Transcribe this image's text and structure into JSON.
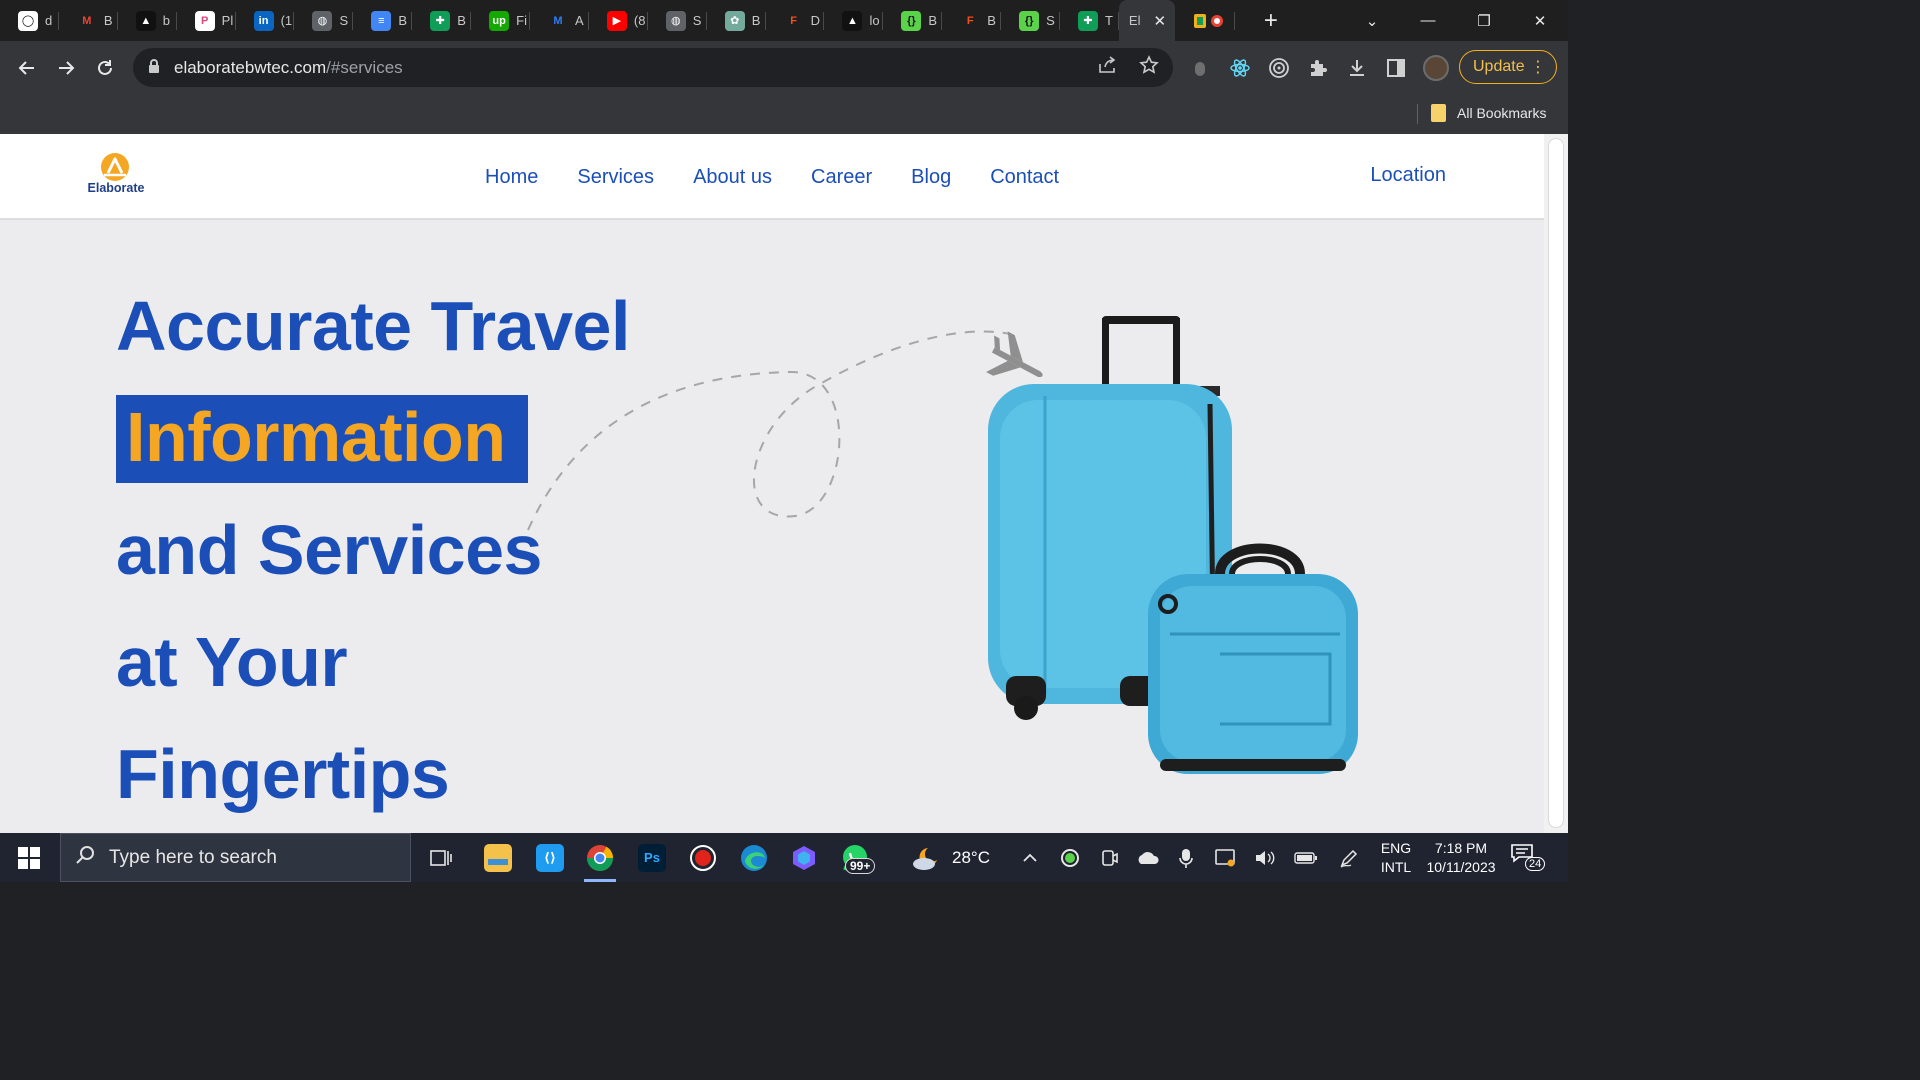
{
  "browser": {
    "tabs": [
      {
        "icon": "github-icon",
        "title": "d",
        "bg": "#ffffff",
        "fg": "#111111",
        "glyph": "◯"
      },
      {
        "icon": "gmail-icon",
        "title": "B",
        "bg": "#1f1f1f",
        "fg": "#ea4335",
        "glyph": "M"
      },
      {
        "icon": "vercel-icon",
        "title": "b",
        "bg": "#111111",
        "fg": "#ffffff",
        "glyph": "▲"
      },
      {
        "icon": "plane-app-icon",
        "title": "Pl",
        "bg": "#ffffff",
        "fg": "#e0457b",
        "glyph": "P"
      },
      {
        "icon": "linkedin-icon",
        "title": "(1",
        "bg": "#0a66c2",
        "fg": "#ffffff",
        "glyph": "in"
      },
      {
        "icon": "globe-icon",
        "title": "S",
        "bg": "#5f6368",
        "fg": "#ffffff",
        "glyph": "◍"
      },
      {
        "icon": "docs-icon",
        "title": "B",
        "bg": "#4285f4",
        "fg": "#ffffff",
        "glyph": "≡"
      },
      {
        "icon": "sheets-icon",
        "title": "B",
        "bg": "#0f9d58",
        "fg": "#ffffff",
        "glyph": "✚"
      },
      {
        "icon": "upwork-icon",
        "title": "Fi",
        "bg": "#14a800",
        "fg": "#ffffff",
        "glyph": "up"
      },
      {
        "icon": "jira-icon",
        "title": "A",
        "bg": "#1f1f1f",
        "fg": "#2f7df6",
        "glyph": "M"
      },
      {
        "icon": "youtube-icon",
        "title": "(8",
        "bg": "#ff0000",
        "fg": "#ffffff",
        "glyph": "▶"
      },
      {
        "icon": "globe-icon",
        "title": "S",
        "bg": "#5f6368",
        "fg": "#ffffff",
        "glyph": "◍"
      },
      {
        "icon": "chatgpt-icon",
        "title": "B",
        "bg": "#74aa9c",
        "fg": "#ffffff",
        "glyph": "✿"
      },
      {
        "icon": "figma-icon",
        "title": "D",
        "bg": "#1f1f1f",
        "fg": "#f24e1e",
        "glyph": "F"
      },
      {
        "icon": "vercel-icon",
        "title": "lo",
        "bg": "#111111",
        "fg": "#ffffff",
        "glyph": "▲"
      },
      {
        "icon": "api-icon",
        "title": "B",
        "bg": "#5ad34a",
        "fg": "#111111",
        "glyph": "{}"
      },
      {
        "icon": "figma-icon",
        "title": "B",
        "bg": "#1f1f1f",
        "fg": "#f24e1e",
        "glyph": "F"
      },
      {
        "icon": "api-icon",
        "title": "S",
        "bg": "#5ad34a",
        "fg": "#111111",
        "glyph": "{}"
      },
      {
        "icon": "sheets-icon",
        "title": "T",
        "bg": "#0f9d58",
        "fg": "#ffffff",
        "glyph": "✚"
      }
    ],
    "active_tab": {
      "title": "El",
      "close": "✕"
    },
    "last_tab": {
      "icon": "recorder-icon"
    },
    "new_tab": "+",
    "window_controls": {
      "menu": "⌄",
      "minimize": "—",
      "restore": "❐",
      "close": "✕"
    },
    "address": {
      "host": "elaboratebwtec.com",
      "path": "/#services"
    },
    "update_label": "Update",
    "bookmarks": {
      "all_label": "All Bookmarks"
    }
  },
  "site": {
    "logo_text": "Elaborate",
    "nav": [
      "Home",
      "Services",
      "About us",
      "Career",
      "Blog",
      "Contact"
    ],
    "location": "Location",
    "hero": {
      "line1": "Accurate Travel",
      "highlight": "Information",
      "line3": "and Services",
      "line4": "at Your",
      "line5": "Fingertips"
    },
    "colors": {
      "brand_blue": "#1b4fb7",
      "accent_orange": "#f5a623",
      "hero_bg": "#ececee",
      "luggage_blue": "#4fb6dd"
    }
  },
  "taskbar": {
    "search_placeholder": "Type here to search",
    "whatsapp_badge": "99+",
    "weather": "28°C",
    "language_1": "ENG",
    "language_2": "INTL",
    "time": "7:18 PM",
    "date": "10/11/2023",
    "notification_count": "24"
  }
}
